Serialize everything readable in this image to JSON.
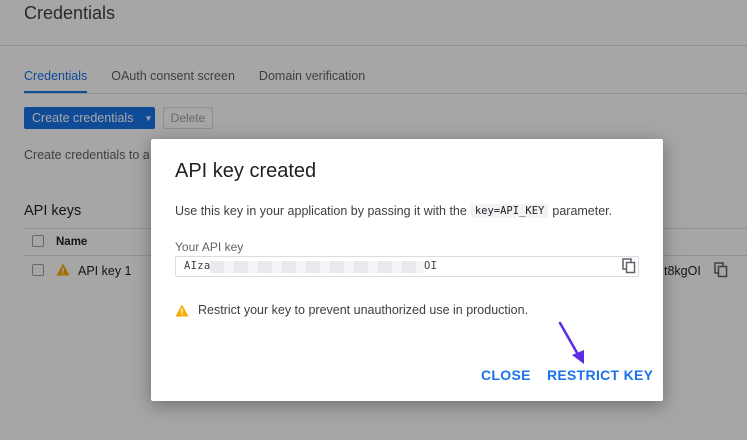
{
  "page": {
    "title": "Credentials",
    "tabs": [
      {
        "label": "Credentials",
        "active": true
      },
      {
        "label": "OAuth consent screen",
        "active": false
      },
      {
        "label": "Domain verification",
        "active": false
      }
    ],
    "create_button": "Create credentials",
    "delete_button": "Delete",
    "description": "Create credentials to access your enabled APIs",
    "api_keys": {
      "section_title": "API keys",
      "column_name": "Name",
      "rows": [
        {
          "name": "API key 1",
          "key_suffix": "t8kgOI",
          "status_icon": "warning-icon"
        }
      ]
    }
  },
  "dialog": {
    "title": "API key created",
    "desc_before": "Use this key in your application by passing it with the",
    "desc_code": "key=API_KEY",
    "desc_after": "parameter.",
    "key_label": "Your API key",
    "key_prefix": "AIza",
    "key_suffix": "OI",
    "warning": "Restrict your key to prevent unauthorized use in production.",
    "close_label": "CLOSE",
    "restrict_label": "RESTRICT KEY"
  },
  "colors": {
    "accent": "#1a73e8",
    "warning": "#f9ab00",
    "annotation_arrow": "#5b2be8"
  }
}
